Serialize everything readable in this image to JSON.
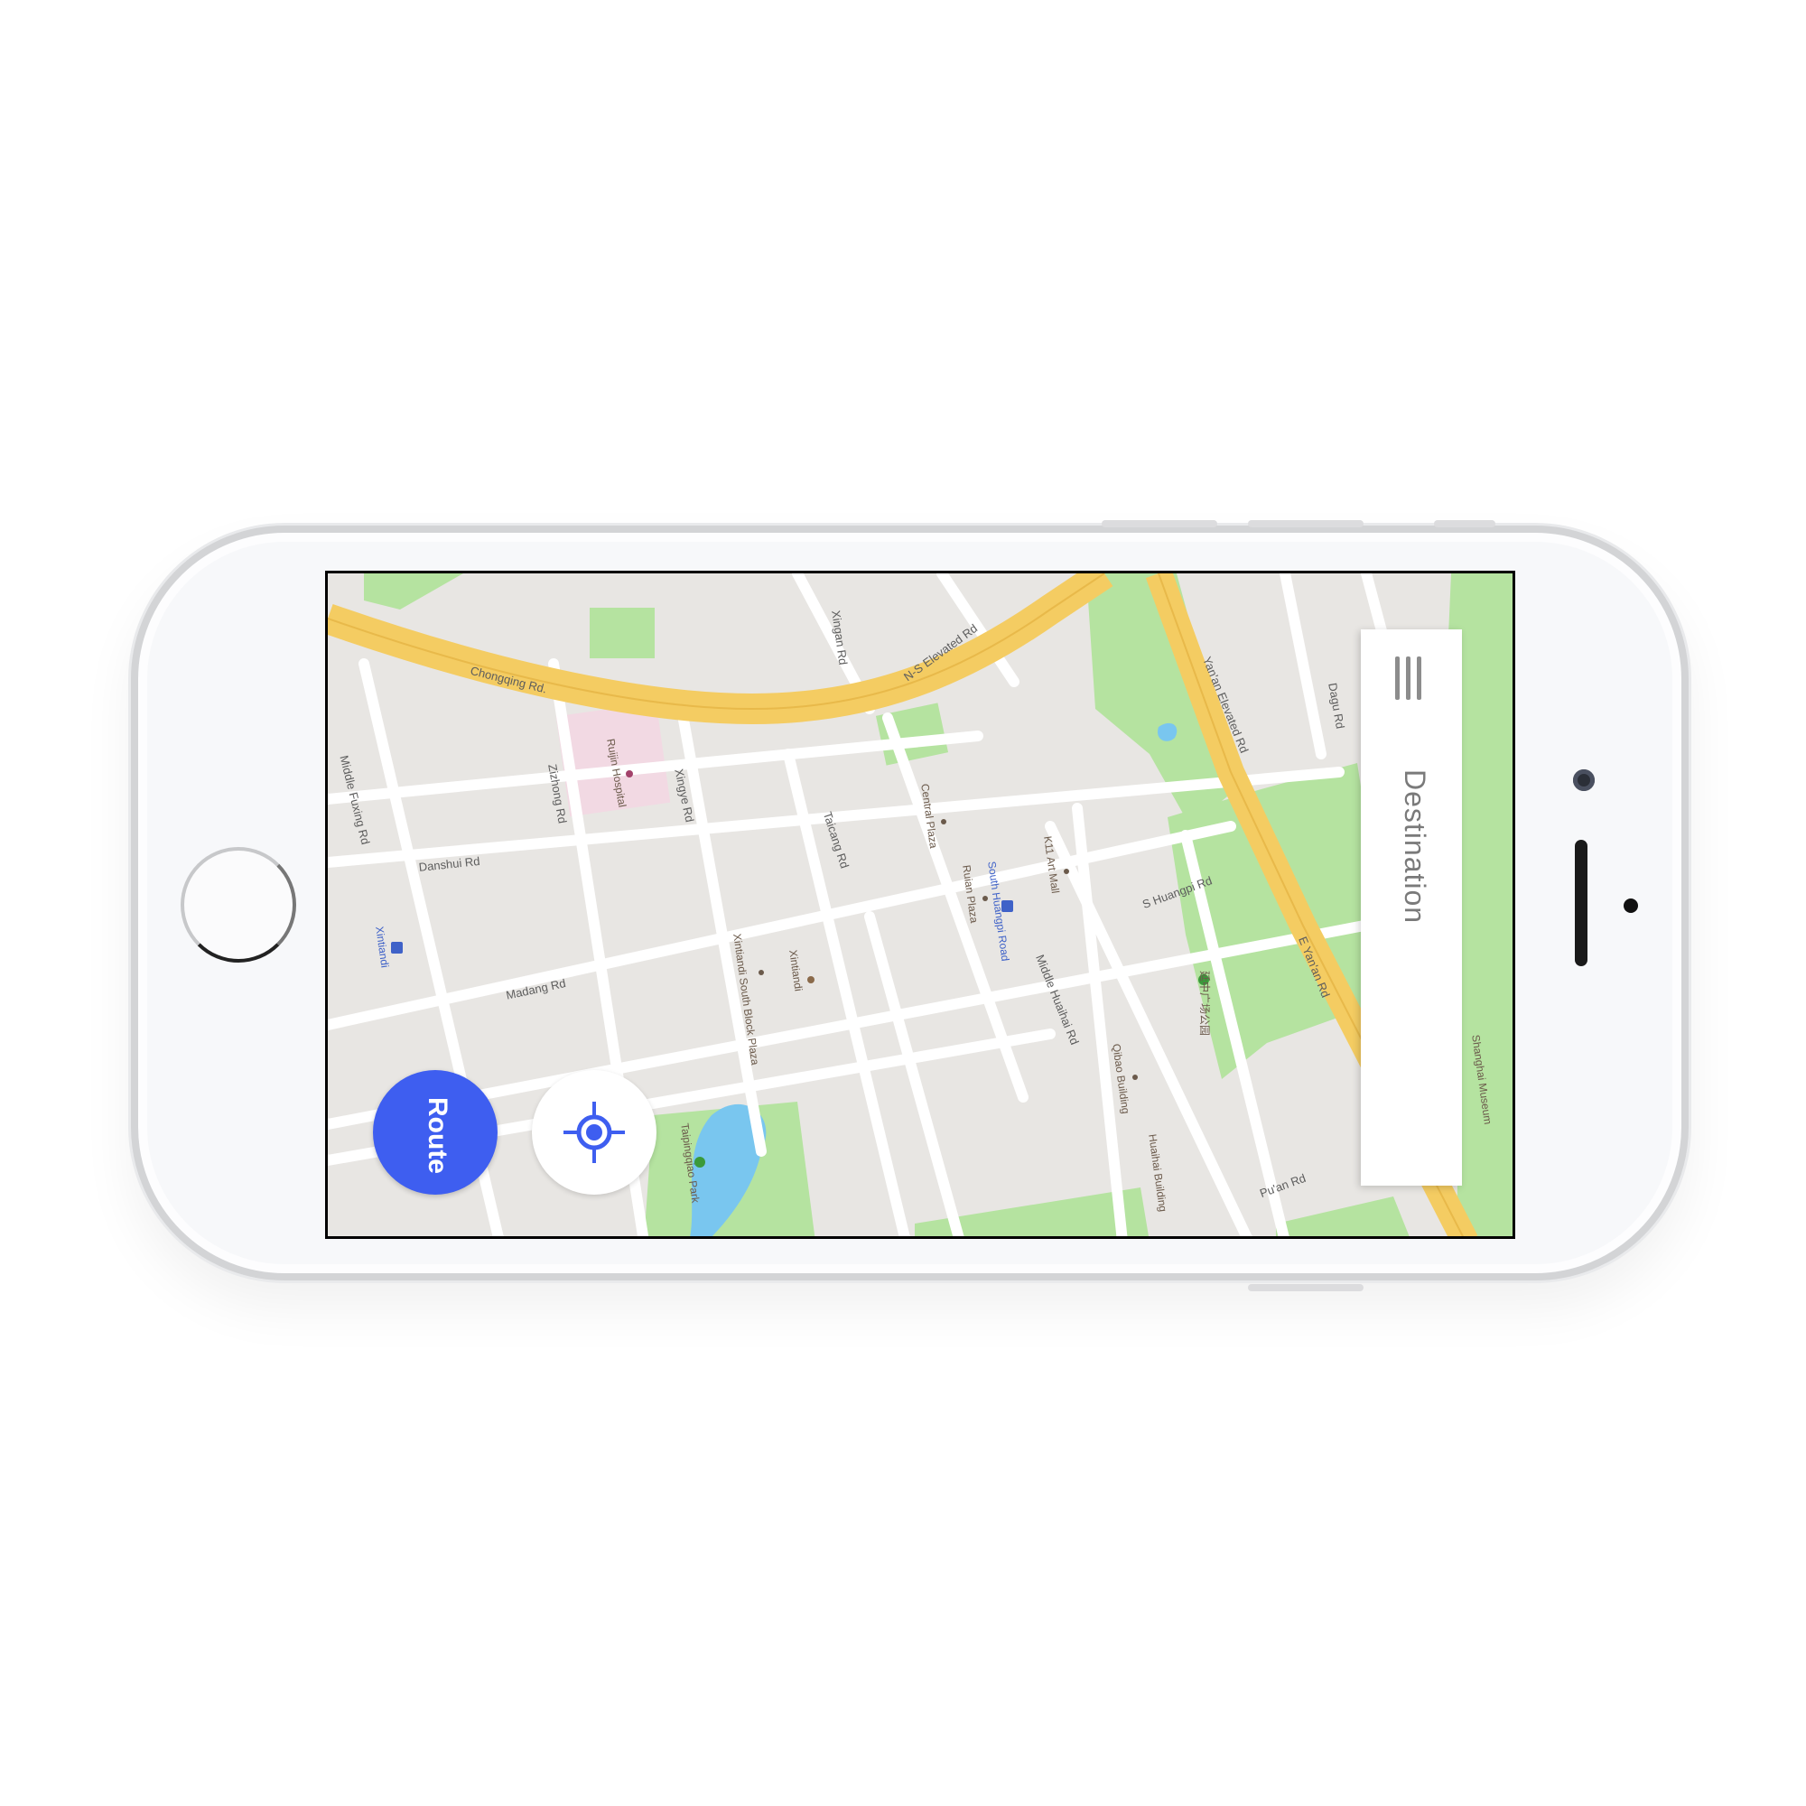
{
  "app": {
    "destination_label": "Destination",
    "route_label": "Route",
    "menu_icon": "hamburger-menu-icon",
    "locate_icon": "crosshair-locate-icon",
    "accent_color": "#3e5ef0"
  },
  "map": {
    "streets": [
      "Chongqing Rd.",
      "N-S Elevated Rd",
      "Xingan Rd",
      "Yan'an Elevated Rd",
      "Dagu Rd",
      "Middle Fuxing Rd",
      "Zizhong Rd",
      "Xingye Rd",
      "Danshui Rd",
      "Taicang Rd",
      "S Huangpi Rd",
      "E Yan'an Rd",
      "Madang Rd",
      "Middle Huaihai Rd",
      "Pu'an Rd"
    ],
    "places": [
      "Ruijin Hospital",
      "Central Plaza",
      "K11 Art Mall",
      "Ruian Plaza",
      "Xintiandi South Block Plaza",
      "Xintiandi",
      "Qibao Building",
      "Huaihai Building",
      "Taipingqiao Park",
      "Shanghai Museum",
      "延中广场公园"
    ],
    "stations": [
      "Xintiandi",
      "South Huangpi Road"
    ]
  }
}
